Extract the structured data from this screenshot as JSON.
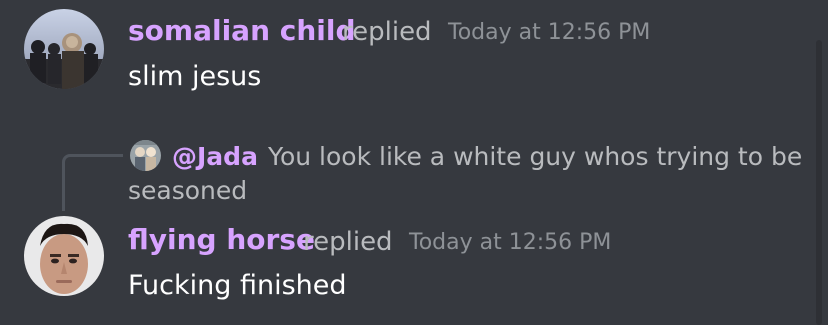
{
  "messages": [
    {
      "username": "somalian child",
      "action": "replied",
      "timestamp": "Today at 12:56 PM",
      "text": "slim jesus",
      "avatar_icon": "group-photo-avatar"
    },
    {
      "username": "flying horse",
      "action": "replied",
      "timestamp": "Today at 12:56 PM",
      "text": "Fucking finished",
      "avatar_icon": "face-photo-avatar",
      "reply_to": {
        "mention": "@Jada",
        "text_line1": "You look like a white guy whos trying to be",
        "text_line2": "seasoned",
        "avatar_icon": "small-photo-avatar"
      }
    }
  ],
  "colors": {
    "background": "#36393f",
    "username": "#d7a3ff",
    "message_text": "#ffffff",
    "muted_text": "#b9bbbe",
    "timestamp": "#8e9297"
  }
}
